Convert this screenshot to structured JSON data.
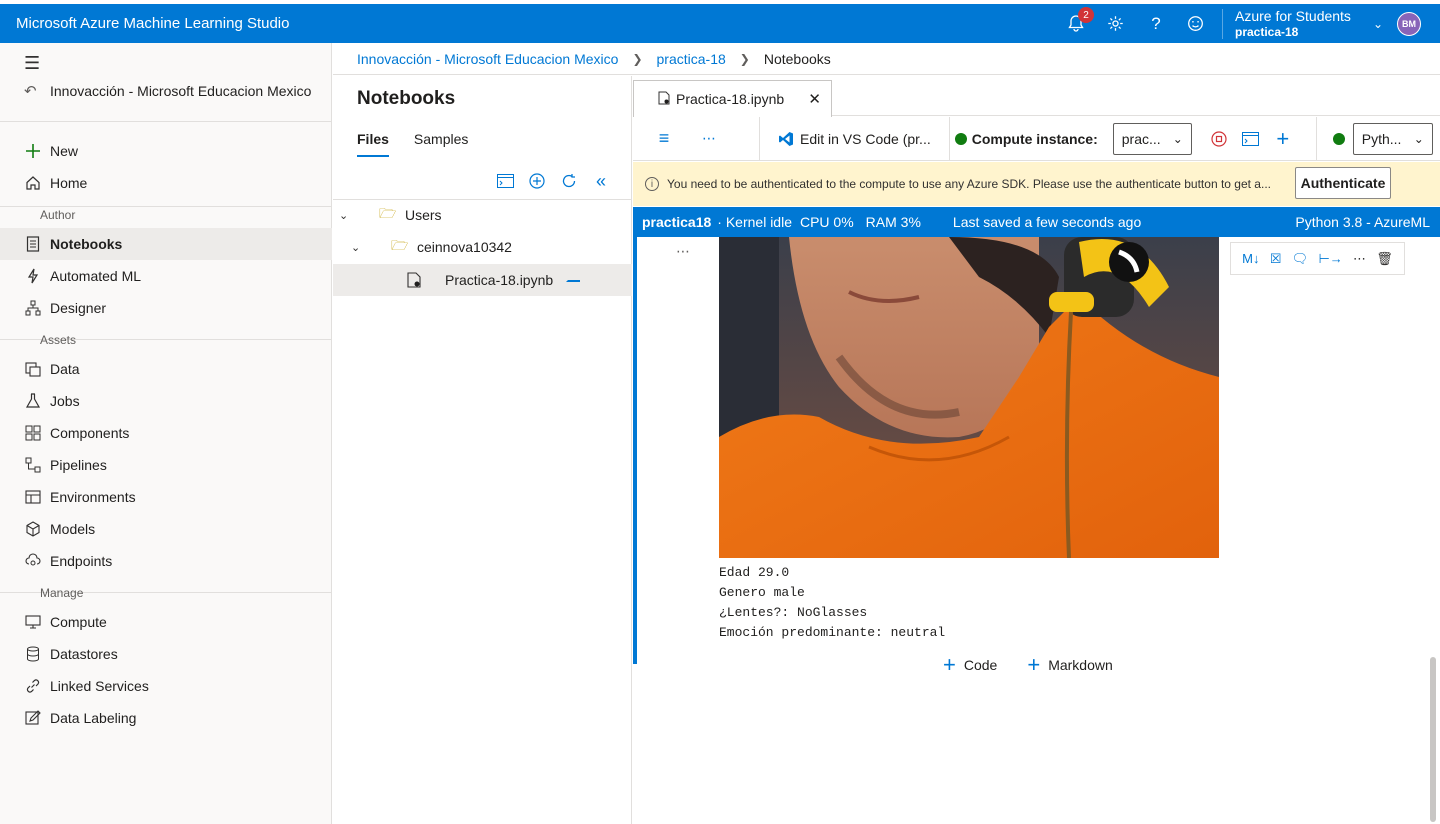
{
  "topbar": {
    "app_title": "Microsoft Azure Machine Learning Studio",
    "notification_count": "2",
    "directory": "Azure for Students",
    "workspace": "practica-18",
    "avatar_initials": "BM",
    "brand_color": "#0078d4"
  },
  "sidebar": {
    "workspace_link": "Innovacción - Microsoft Educacion Mexico",
    "top_items": [
      {
        "label": "New",
        "icon": "plus-icon"
      },
      {
        "label": "Home",
        "icon": "home-icon"
      }
    ],
    "groups": {
      "author": "Author",
      "assets": "Assets",
      "manage": "Manage"
    },
    "author_items": [
      {
        "label": "Notebooks",
        "icon": "notebook-icon",
        "active": true
      },
      {
        "label": "Automated ML",
        "icon": "automl-icon"
      },
      {
        "label": "Designer",
        "icon": "designer-icon"
      }
    ],
    "assets_items": [
      {
        "label": "Data",
        "icon": "data-icon"
      },
      {
        "label": "Jobs",
        "icon": "flask-icon"
      },
      {
        "label": "Components",
        "icon": "components-icon"
      },
      {
        "label": "Pipelines",
        "icon": "pipeline-icon"
      },
      {
        "label": "Environments",
        "icon": "environment-icon"
      },
      {
        "label": "Models",
        "icon": "cube-icon"
      },
      {
        "label": "Endpoints",
        "icon": "endpoint-icon"
      }
    ],
    "manage_items": [
      {
        "label": "Compute",
        "icon": "monitor-icon"
      },
      {
        "label": "Datastores",
        "icon": "database-icon"
      },
      {
        "label": "Linked Services",
        "icon": "link-icon"
      },
      {
        "label": "Data Labeling",
        "icon": "edit-icon"
      }
    ]
  },
  "breadcrumb": {
    "items": [
      "Innovacción - Microsoft Educacion Mexico",
      "practica-18"
    ],
    "current": "Notebooks"
  },
  "files_panel": {
    "title": "Notebooks",
    "tabs": [
      "Files",
      "Samples"
    ],
    "active_tab": "Files",
    "tree": {
      "root": "Users",
      "user_folder": "ceinnova10342",
      "file": "Practica-18.ipynb"
    }
  },
  "editor": {
    "tab_label": "Practica-18.ipynb",
    "toolbar": {
      "vscode_label": "Edit in VS Code (pr...",
      "compute_label": "Compute instance:",
      "compute_value": "prac...",
      "kernel_value": "Pyth..."
    },
    "auth_bar": {
      "message": "You need to be authenticated to the compute to use any Azure SDK. Please use the authenticate button to get a...",
      "button": "Authenticate"
    },
    "kernel_bar": {
      "compute": "practica18",
      "status": "· Kernel idle",
      "cpu": "CPU  0%",
      "ram": "RAM  3%",
      "saved": "Last saved a few seconds ago",
      "runtime": "Python 3.8 - AzureML"
    },
    "output_lines": [
      "Edad 29.0",
      "Genero male",
      "¿Lentes?: NoGlasses",
      "Emoción predominante: neutral"
    ],
    "add_code": "Code",
    "add_markdown": "Markdown"
  }
}
